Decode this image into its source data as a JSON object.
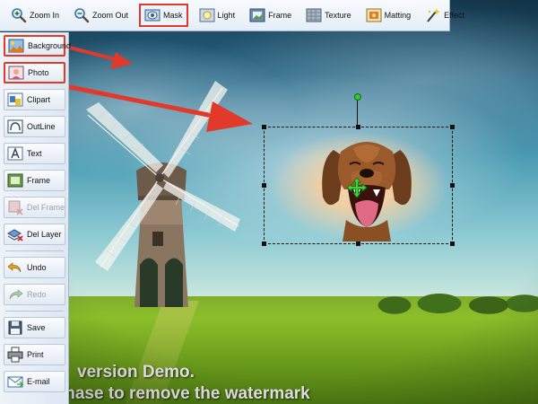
{
  "toolbar": {
    "items": [
      {
        "label": "Zoom In",
        "icon": "zoom-in-icon"
      },
      {
        "label": "Zoom Out",
        "icon": "zoom-out-icon"
      },
      {
        "label": "Mask",
        "icon": "mask-icon",
        "highlighted": true
      },
      {
        "label": "Light",
        "icon": "light-icon"
      },
      {
        "label": "Frame",
        "icon": "frame-icon"
      },
      {
        "label": "Texture",
        "icon": "texture-icon"
      },
      {
        "label": "Matting",
        "icon": "matting-icon"
      },
      {
        "label": "Effect",
        "icon": "effect-icon"
      }
    ]
  },
  "sidebar": {
    "items": [
      {
        "label": "Background",
        "icon": "background-icon",
        "highlighted": true
      },
      {
        "label": "Photo",
        "icon": "photo-icon",
        "highlighted": true
      },
      {
        "label": "Clipart",
        "icon": "clipart-icon"
      },
      {
        "label": "OutLine",
        "icon": "outline-icon"
      },
      {
        "label": "Text",
        "icon": "text-icon"
      },
      {
        "label": "Frame",
        "icon": "frame-icon"
      },
      {
        "label": "Del Frame",
        "icon": "delete-frame-icon",
        "disabled": true
      },
      {
        "label": "Del Layer",
        "icon": "delete-layer-icon"
      },
      {
        "label": "Undo",
        "icon": "undo-icon"
      },
      {
        "label": "Redo",
        "icon": "redo-icon",
        "disabled": true
      },
      {
        "label": "Save",
        "icon": "save-icon"
      },
      {
        "label": "Print",
        "icon": "print-icon"
      },
      {
        "label": "E-mail",
        "icon": "email-icon"
      }
    ]
  },
  "canvas": {
    "watermark_line1": "version Demo.",
    "watermark_line2": "Purchase to remove the watermark"
  },
  "colors": {
    "highlight": "#e23a2a",
    "arrow": "#e23a2a",
    "rotate_handle": "#2fcc2f"
  }
}
